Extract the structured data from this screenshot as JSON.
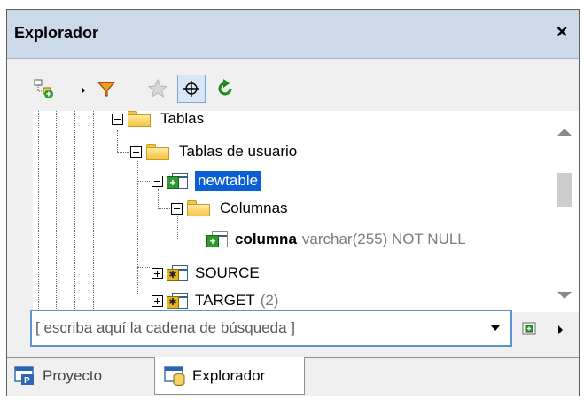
{
  "window": {
    "title": "Explorador",
    "close_glyph": "×"
  },
  "toolbar": {
    "buttons": [
      {
        "name": "add-object-icon"
      },
      {
        "name": "filter-icon"
      },
      {
        "name": "favorites-star-icon"
      },
      {
        "name": "locate-crosshair-icon",
        "pressed": true
      },
      {
        "name": "refresh-icon"
      }
    ]
  },
  "tree": {
    "nodes": [
      {
        "label": "Tablas",
        "expander": "minus",
        "icon": "folder"
      },
      {
        "label": "Tablas de usuario",
        "expander": "minus",
        "icon": "folder"
      },
      {
        "label": "newtable",
        "expander": "minus",
        "icon": "table-new",
        "selected": true
      },
      {
        "label": "Columnas",
        "expander": "minus",
        "icon": "folder"
      },
      {
        "label": "columna",
        "detail": "varchar(255) NOT NULL",
        "icon": "column-new"
      },
      {
        "label": "SOURCE",
        "expander": "plus",
        "icon": "table-alias"
      },
      {
        "label": "TARGET",
        "detail": "(2)",
        "expander": "plus",
        "icon": "table-alias"
      }
    ]
  },
  "search": {
    "placeholder": "[ escriba aquí la cadena de búsqueda ]",
    "value": ""
  },
  "tabs": [
    {
      "label": "Proyecto",
      "active": false
    },
    {
      "label": "Explorador",
      "active": true
    }
  ],
  "colors": {
    "titlebar": "#ccd9e8",
    "selection": "#0a5fd6",
    "search_border": "#5a93d6"
  }
}
